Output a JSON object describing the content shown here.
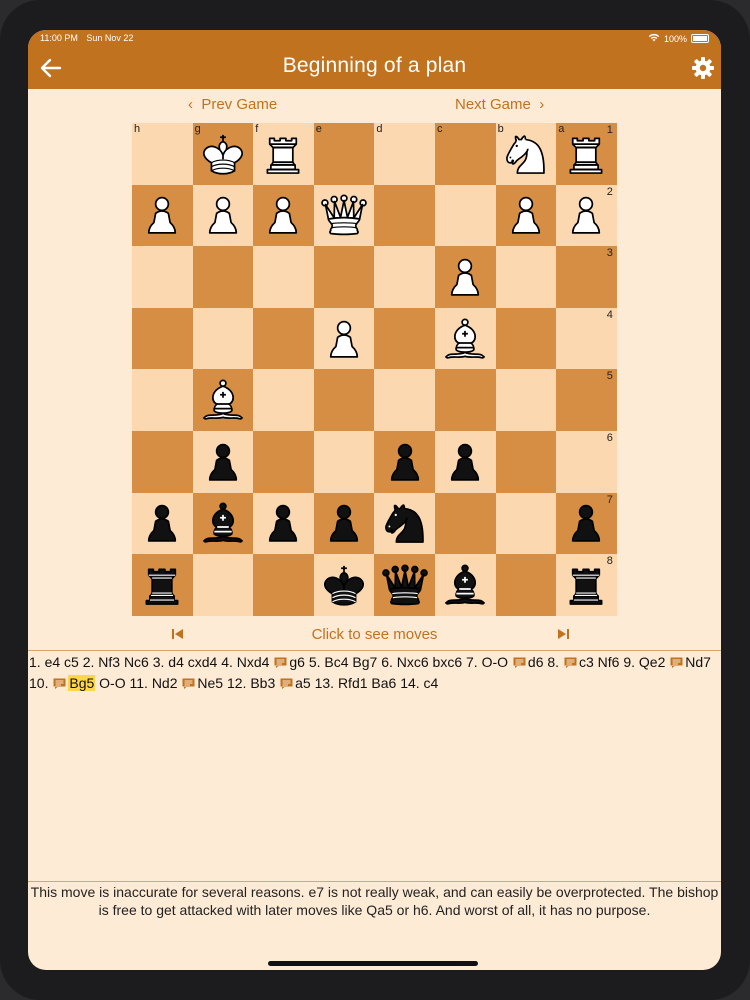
{
  "status_bar": {
    "time": "11:00 PM",
    "date": "Sun Nov 22",
    "battery": "100%",
    "wifi_icon": "wifi-icon",
    "battery_icon": "battery-icon"
  },
  "nav": {
    "title": "Beginning of a plan",
    "back_icon": "back-arrow-icon",
    "settings_icon": "gear-icon"
  },
  "game_nav": {
    "prev": "Prev Game",
    "next": "Next Game"
  },
  "board": {
    "orientation": "black-bottom",
    "file_labels": [
      "h",
      "g",
      "f",
      "e",
      "d",
      "c",
      "b",
      "a"
    ],
    "rank_labels": [
      "1",
      "2",
      "3",
      "4",
      "5",
      "6",
      "7",
      "8"
    ],
    "light_color": "#fcd8b1",
    "dark_color": "#d68e45",
    "pieces": [
      {
        "square": "g1",
        "piece": "K",
        "color": "white"
      },
      {
        "square": "f1",
        "piece": "R",
        "color": "white"
      },
      {
        "square": "b1",
        "piece": "N",
        "color": "white"
      },
      {
        "square": "a1",
        "piece": "R",
        "color": "white"
      },
      {
        "square": "h2",
        "piece": "P",
        "color": "white"
      },
      {
        "square": "g2",
        "piece": "P",
        "color": "white"
      },
      {
        "square": "f2",
        "piece": "P",
        "color": "white"
      },
      {
        "square": "e2",
        "piece": "Q",
        "color": "white"
      },
      {
        "square": "b2",
        "piece": "P",
        "color": "white"
      },
      {
        "square": "a2",
        "piece": "P",
        "color": "white"
      },
      {
        "square": "c3",
        "piece": "P",
        "color": "white"
      },
      {
        "square": "e4",
        "piece": "P",
        "color": "white"
      },
      {
        "square": "c4",
        "piece": "B",
        "color": "white"
      },
      {
        "square": "g5",
        "piece": "B",
        "color": "white"
      },
      {
        "square": "g6",
        "piece": "P",
        "color": "black"
      },
      {
        "square": "d6",
        "piece": "P",
        "color": "black"
      },
      {
        "square": "c6",
        "piece": "P",
        "color": "black"
      },
      {
        "square": "h7",
        "piece": "P",
        "color": "black"
      },
      {
        "square": "g7",
        "piece": "B",
        "color": "black"
      },
      {
        "square": "f7",
        "piece": "P",
        "color": "black"
      },
      {
        "square": "e7",
        "piece": "P",
        "color": "black"
      },
      {
        "square": "d7",
        "piece": "N",
        "color": "black"
      },
      {
        "square": "a7",
        "piece": "P",
        "color": "black"
      },
      {
        "square": "h8",
        "piece": "R",
        "color": "black"
      },
      {
        "square": "e8",
        "piece": "K",
        "color": "black"
      },
      {
        "square": "d8",
        "piece": "Q",
        "color": "black"
      },
      {
        "square": "c8",
        "piece": "B",
        "color": "black"
      },
      {
        "square": "a8",
        "piece": "R",
        "color": "black"
      }
    ]
  },
  "move_controls": {
    "first_icon": "skip-to-start-icon",
    "hint": "Click to see moves",
    "last_icon": "skip-to-end-icon"
  },
  "moves": [
    {
      "text": "1. e4 c5 2. Nf3 Nc6 3. d4 cxd4 4. Nxd4 "
    },
    {
      "comment": true,
      "text": "g6"
    },
    {
      "text": " 5. Bc4 Bg7 6. Nxc6 bxc6 7. O-O "
    },
    {
      "comment": true,
      "text": "d6"
    },
    {
      "text": " 8. "
    },
    {
      "comment": true,
      "text": "c3"
    },
    {
      "text": " Nf6 9. Qe2 "
    },
    {
      "comment": true,
      "text": "Nd7"
    },
    {
      "text": " 10. "
    },
    {
      "comment": true,
      "text": "Bg5",
      "current": true
    },
    {
      "text": " O-O 11. Nd2 "
    },
    {
      "comment": true,
      "text": "Ne5"
    },
    {
      "text": " 12. Bb3 "
    },
    {
      "comment": true,
      "text": "a5"
    },
    {
      "text": " 13. Rfd1 Ba6 14. c4"
    }
  ],
  "comment": "This move is inaccurate for several reasons. e7 is not really weak, and can easily be overprotected. The bishop is free to get attacked with later moves like Qa5 or h6. And worst of all, it has no purpose."
}
